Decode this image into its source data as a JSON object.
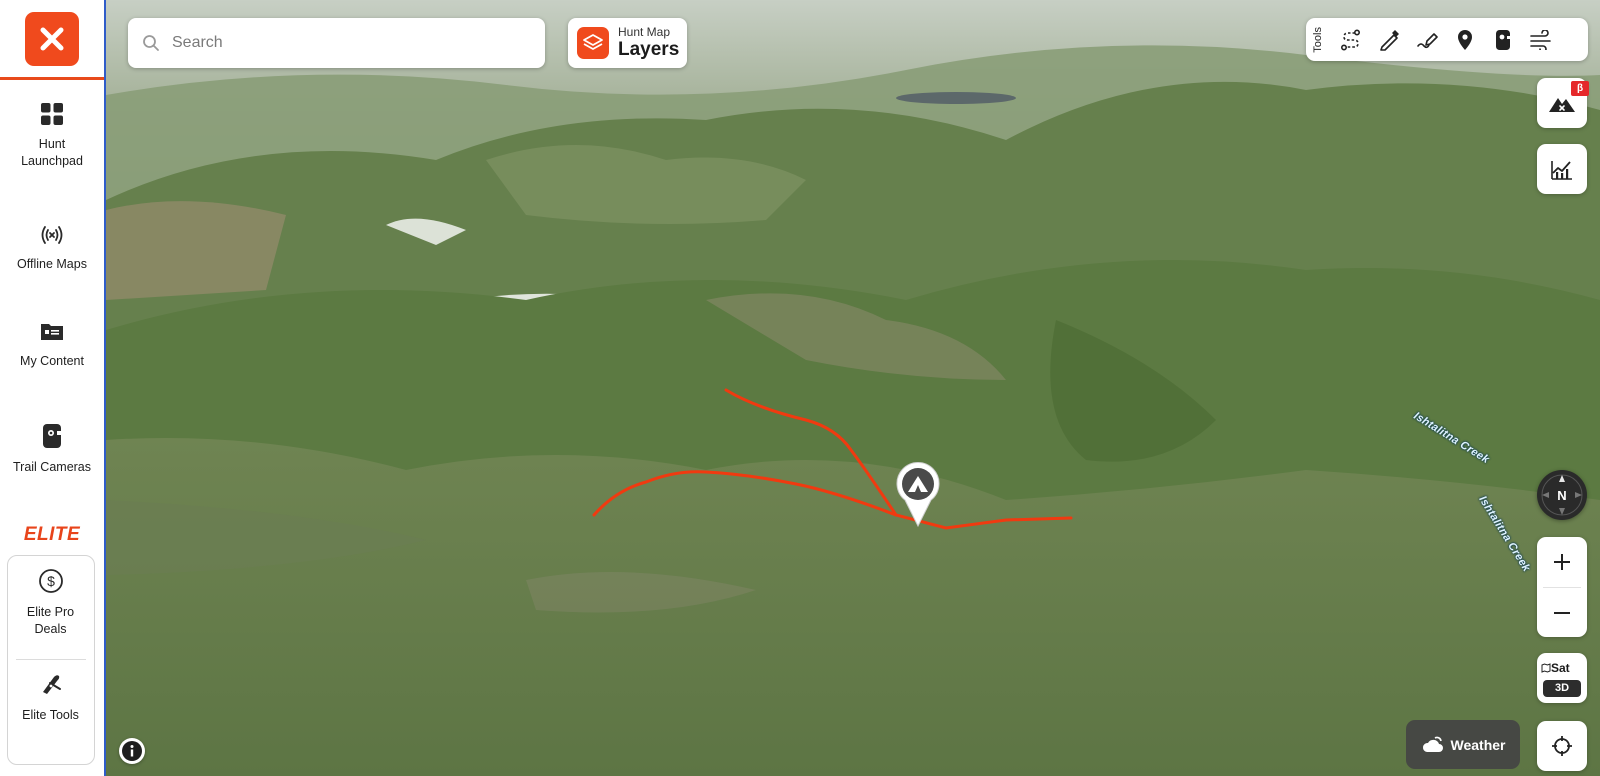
{
  "sidebar": {
    "logo_icon": "close-icon",
    "items": [
      {
        "label": "Hunt Launchpad",
        "icon": "grid-icon"
      },
      {
        "label": "Offline Maps",
        "icon": "broadcast-icon"
      },
      {
        "label": "My Content",
        "icon": "folder-icon"
      },
      {
        "label": "Trail Cameras",
        "icon": "trail-camera-icon"
      }
    ],
    "elite_label": "ELITE",
    "elite_items": [
      {
        "label": "Elite Pro Deals",
        "icon": "dollar-icon"
      },
      {
        "label": "Elite Tools",
        "icon": "pocket-knife-icon"
      }
    ]
  },
  "search": {
    "placeholder": "Search"
  },
  "layers": {
    "subtitle": "Hunt Map",
    "title": "Layers"
  },
  "tools": {
    "label": "Tools",
    "items": [
      "route-icon",
      "line-icon",
      "draw-icon",
      "marker-icon",
      "trail-camera-icon",
      "wind-icon"
    ]
  },
  "map_controls": {
    "beta_badge": "β",
    "compass_label": "N",
    "layer_mode": "Sat",
    "view_mode": "3D",
    "weather_label": "Weather"
  },
  "map_labels": {
    "creek_1": "Ishtalitna Creek",
    "creek_2": "Ishtalitna Creek"
  },
  "colors": {
    "brand": "#f04a1d",
    "sidebar_accent": "#2f5cc9",
    "route": "#f03a10"
  }
}
